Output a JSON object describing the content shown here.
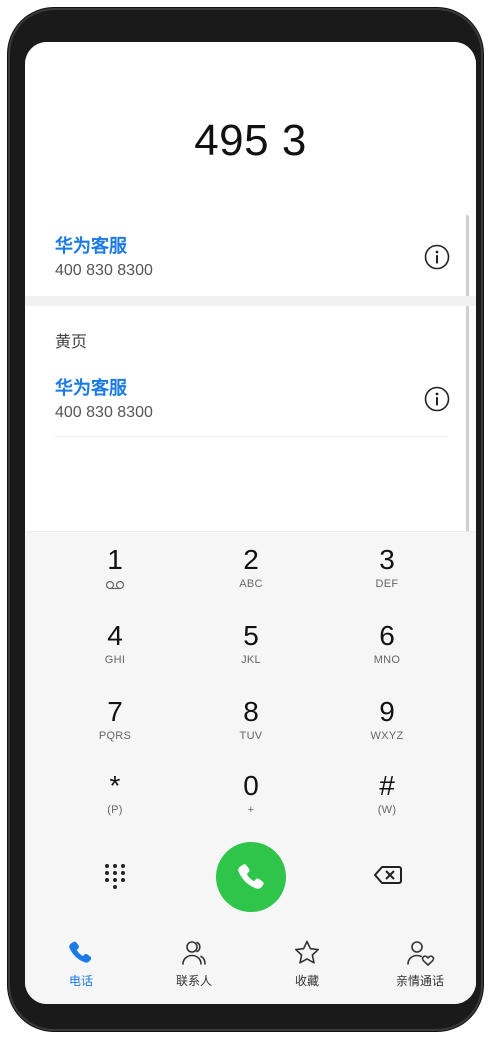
{
  "dialer": {
    "number": "495 3"
  },
  "results": [
    {
      "name": "华为客服",
      "phone": "400 830 8300"
    }
  ],
  "yellow_pages": {
    "label": "黄页",
    "items": [
      {
        "name": "华为客服",
        "phone": "400 830 8300"
      }
    ]
  },
  "keypad": {
    "keys": [
      {
        "digit": "1",
        "sub": "voicemail-icon"
      },
      {
        "digit": "2",
        "sub": "ABC"
      },
      {
        "digit": "3",
        "sub": "DEF"
      },
      {
        "digit": "4",
        "sub": "GHI"
      },
      {
        "digit": "5",
        "sub": "JKL"
      },
      {
        "digit": "6",
        "sub": "MNO"
      },
      {
        "digit": "7",
        "sub": "PQRS"
      },
      {
        "digit": "8",
        "sub": "TUV"
      },
      {
        "digit": "9",
        "sub": "WXYZ"
      },
      {
        "digit": "*",
        "sub": "(P)"
      },
      {
        "digit": "0",
        "sub": "+"
      },
      {
        "digit": "#",
        "sub": "(W)"
      }
    ]
  },
  "tabs": [
    {
      "label": "电话",
      "icon": "phone-icon",
      "active": true
    },
    {
      "label": "联系人",
      "icon": "contacts-icon",
      "active": false
    },
    {
      "label": "收藏",
      "icon": "star-icon",
      "active": false
    },
    {
      "label": "亲情通话",
      "icon": "family-call-icon",
      "active": false
    }
  ],
  "colors": {
    "accent": "#1a7ae6",
    "call_green": "#2fc54a"
  }
}
